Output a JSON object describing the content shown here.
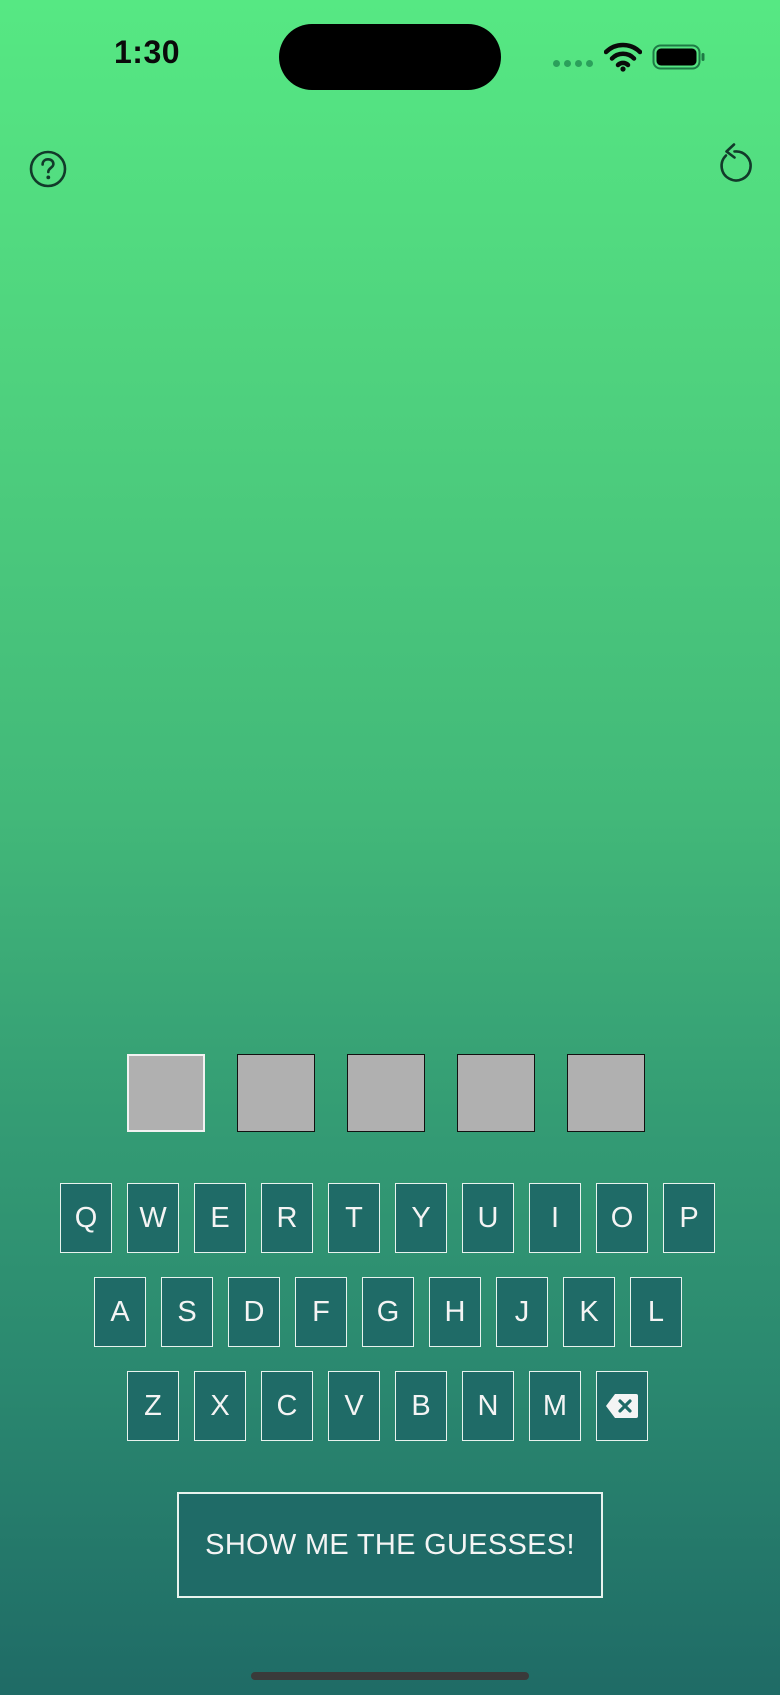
{
  "status_bar": {
    "time": "1:30",
    "wifi_icon": "wifi-icon",
    "battery_icon": "battery-icon"
  },
  "toolbar": {
    "help_icon": "question-circle-icon",
    "restart_icon": "rotate-ccw-icon"
  },
  "guess": {
    "boxes": [
      "",
      "",
      "",
      "",
      ""
    ]
  },
  "keyboard": {
    "row1": [
      "Q",
      "W",
      "E",
      "R",
      "T",
      "Y",
      "U",
      "I",
      "O",
      "P"
    ],
    "row2": [
      "A",
      "S",
      "D",
      "F",
      "G",
      "H",
      "J",
      "K",
      "L"
    ],
    "row3": [
      "Z",
      "X",
      "C",
      "V",
      "B",
      "N",
      "M"
    ],
    "backspace_icon": "backspace-icon"
  },
  "actions": {
    "show_guesses_label": "SHOW ME THE GUESSES!"
  },
  "colors": {
    "gradient_top": "#56e883",
    "gradient_bottom": "#1f6b66",
    "key_fill": "#1f6b67",
    "guess_box_fill": "#b0b0b0"
  }
}
